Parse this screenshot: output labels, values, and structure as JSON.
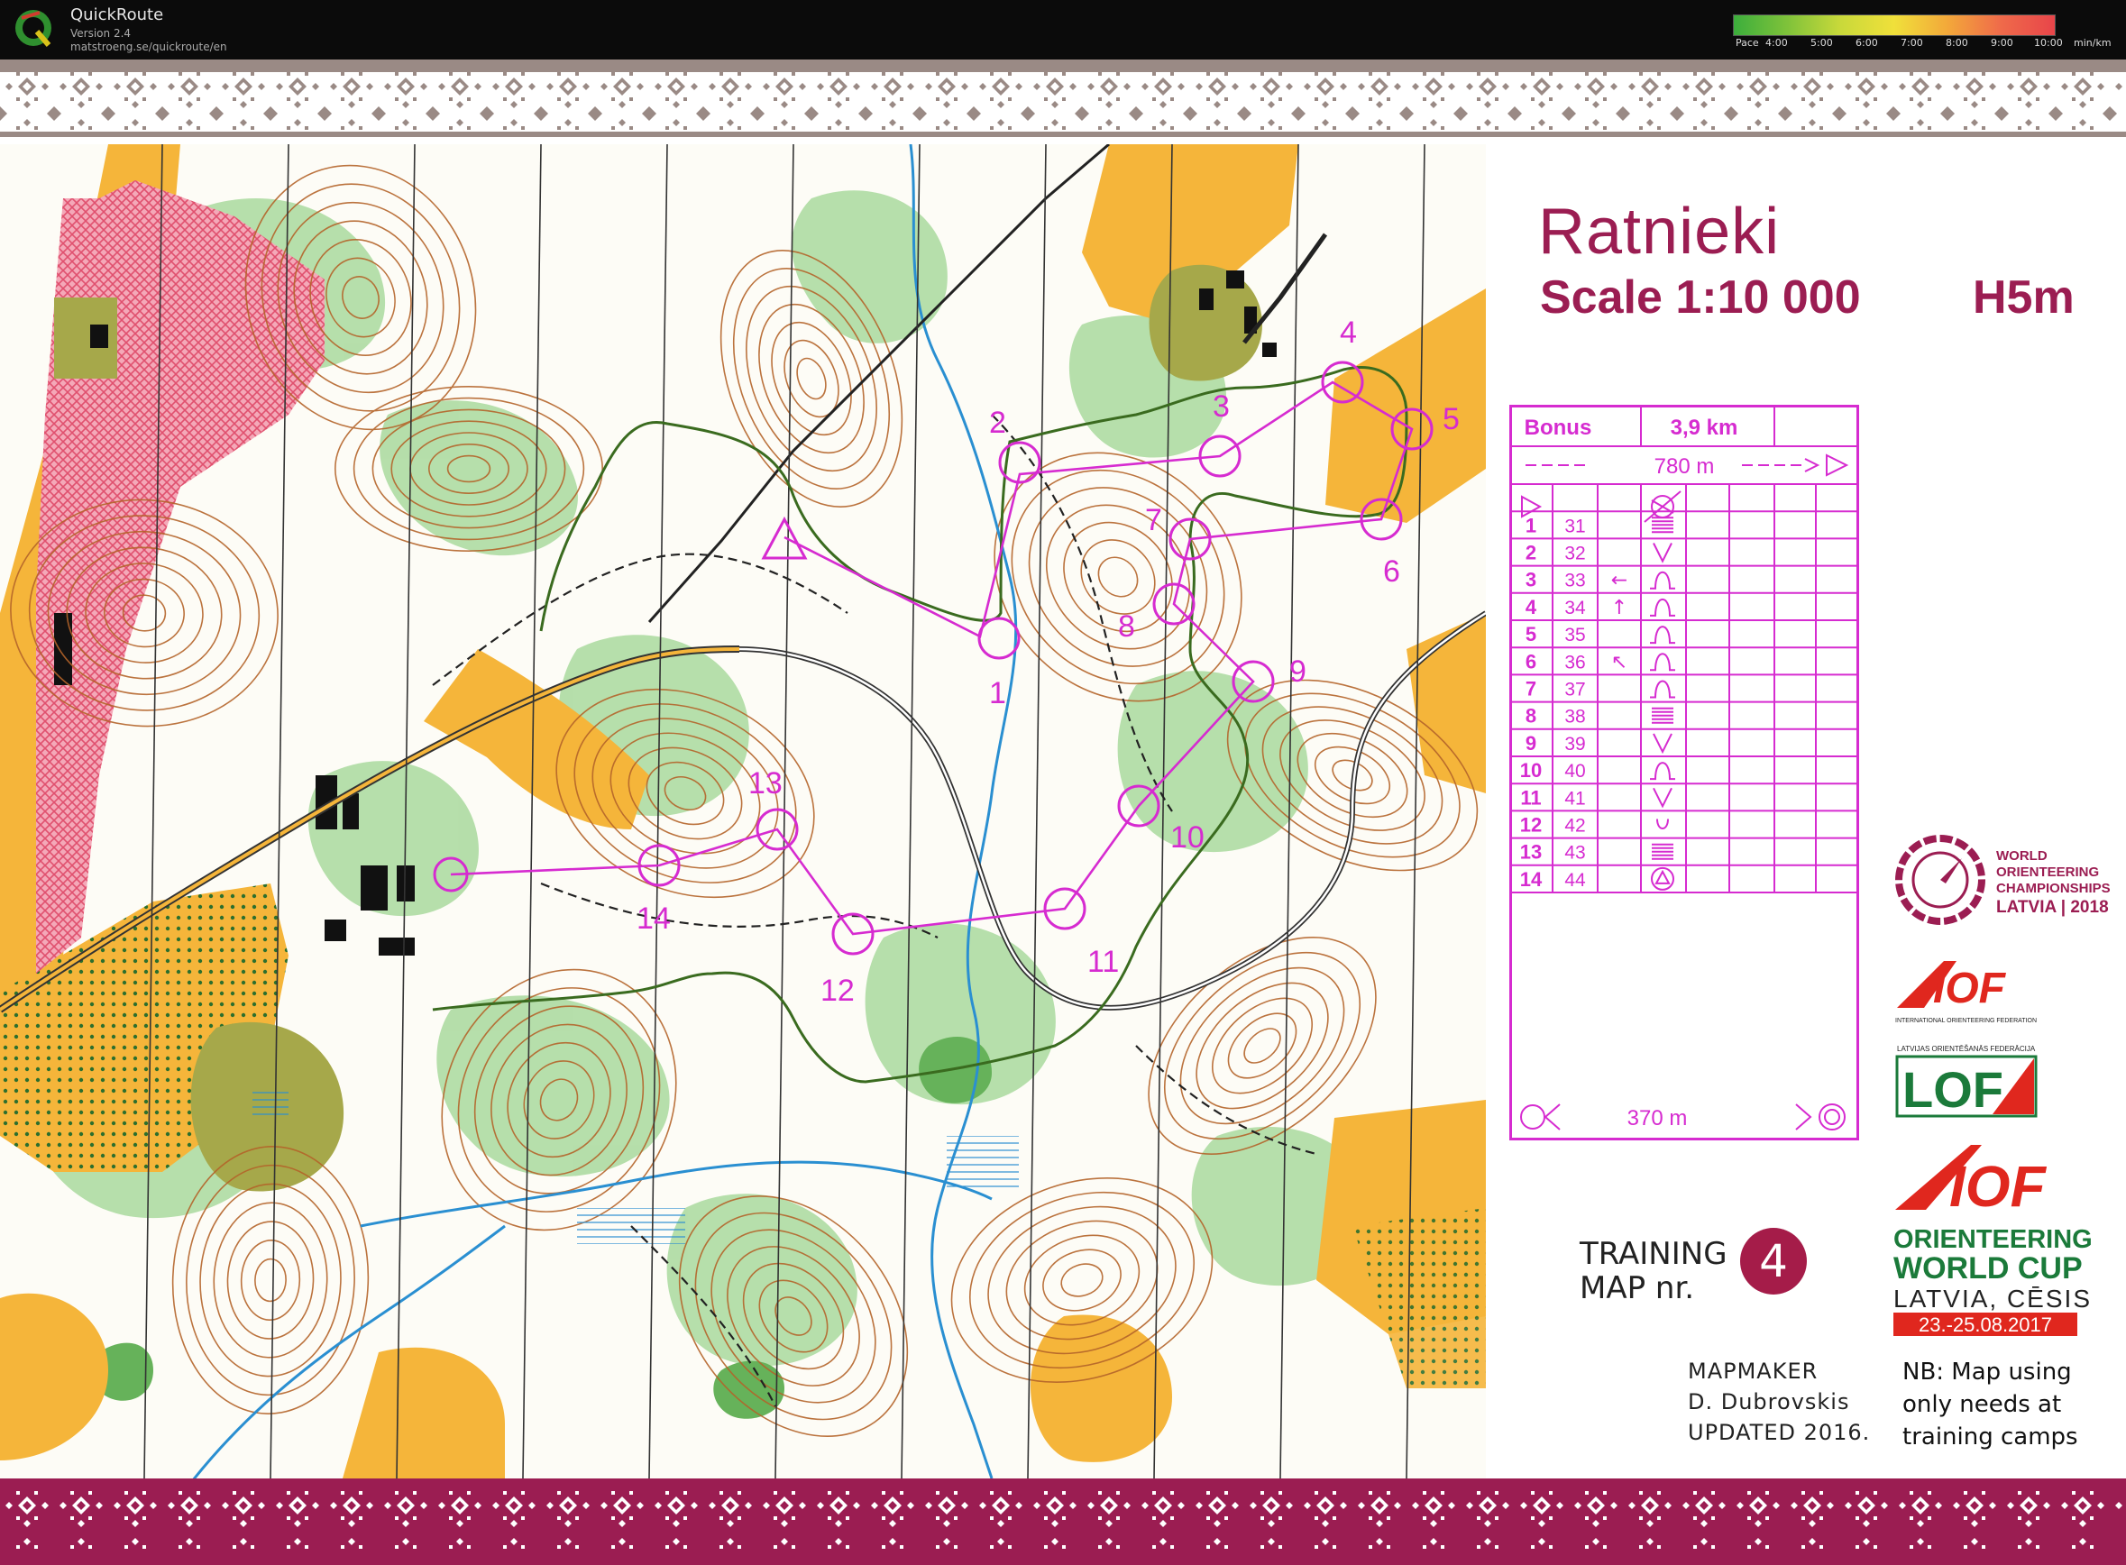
{
  "app": {
    "name": "QuickRoute",
    "version": "Version 2.4",
    "url": "matstroeng.se/quickroute/en"
  },
  "pace_legend": {
    "label": "Pace",
    "ticks": [
      "4:00",
      "5:00",
      "6:00",
      "7:00",
      "8:00",
      "9:00",
      "10:00"
    ],
    "unit": "min/km",
    "colors": [
      "#3cae3c",
      "#7fc23a",
      "#c9d93a",
      "#f0e03a",
      "#f3a83a",
      "#ef6a4a",
      "#e8454a"
    ]
  },
  "map": {
    "title": "Ratnieki",
    "scale": "Scale 1:10 000",
    "contour": "H5m",
    "colors": {
      "course": "#d62bd0",
      "route": "#3a6b1f",
      "brand": "#9b1d52",
      "open": "#f5b53a",
      "forest_green": "#9fd494",
      "restricted": "#f07a9a",
      "water": "#2a8fd1",
      "contour": "#b4642a"
    },
    "controls": [
      {
        "label": "1"
      },
      {
        "label": "2"
      },
      {
        "label": "3"
      },
      {
        "label": "4"
      },
      {
        "label": "5"
      },
      {
        "label": "6"
      },
      {
        "label": "7"
      },
      {
        "label": "8"
      },
      {
        "label": "9"
      },
      {
        "label": "10"
      },
      {
        "label": "11"
      },
      {
        "label": "12"
      },
      {
        "label": "13"
      },
      {
        "label": "14"
      }
    ]
  },
  "course": {
    "name": "Bonus",
    "length": "3,9 km",
    "start_distance": "780 m",
    "finish_distance": "370 m",
    "rows": [
      {
        "num": "1",
        "code": "31",
        "arrow": "",
        "symbol": "equal"
      },
      {
        "num": "2",
        "code": "32",
        "arrow": "",
        "symbol": "V"
      },
      {
        "num": "3",
        "code": "33",
        "arrow": "←",
        "symbol": "bump"
      },
      {
        "num": "4",
        "code": "34",
        "arrow": "↑",
        "symbol": "bump"
      },
      {
        "num": "5",
        "code": "35",
        "arrow": "",
        "symbol": "bump"
      },
      {
        "num": "6",
        "code": "36",
        "arrow": "↖",
        "symbol": "bump"
      },
      {
        "num": "7",
        "code": "37",
        "arrow": "",
        "symbol": "bump"
      },
      {
        "num": "8",
        "code": "38",
        "arrow": "",
        "symbol": "equal"
      },
      {
        "num": "9",
        "code": "39",
        "arrow": "",
        "symbol": "V"
      },
      {
        "num": "10",
        "code": "40",
        "arrow": "",
        "symbol": "bump"
      },
      {
        "num": "11",
        "code": "41",
        "arrow": "",
        "symbol": "V"
      },
      {
        "num": "12",
        "code": "42",
        "arrow": "",
        "symbol": "U"
      },
      {
        "num": "13",
        "code": "43",
        "arrow": "",
        "symbol": "equal"
      },
      {
        "num": "14",
        "code": "44",
        "arrow": "",
        "symbol": "triangle"
      }
    ]
  },
  "logos": {
    "woc": {
      "line1": "WORLD",
      "line2": "ORIENTEERING",
      "line3": "CHAMPIONSHIPS",
      "line4": "LATVIA | 2018"
    },
    "iof1": {
      "mark": "IOF",
      "caption": "INTERNATIONAL ORIENTEERING FEDERATION"
    },
    "lof": {
      "caption": "LATVIJAS ORIENTĒŠANĀS FEDERĀCIJA",
      "mark": "LOF"
    },
    "wc": {
      "mark": "IOF",
      "line1": "ORIENTEERING",
      "line2": "WORLD CUP",
      "line3": "LATVIA, CĒSIS",
      "line4": "23.-25.08.2017"
    }
  },
  "training": {
    "line1": "TRAINING",
    "line2": "MAP nr.",
    "number": "4"
  },
  "mapmaker": {
    "label": "MAPMAKER",
    "name": "D. Dubrovskis",
    "updated": "UPDATED 2016."
  },
  "note": {
    "line1": "NB: Map using",
    "line2": "only needs at",
    "line3": "training camps"
  }
}
